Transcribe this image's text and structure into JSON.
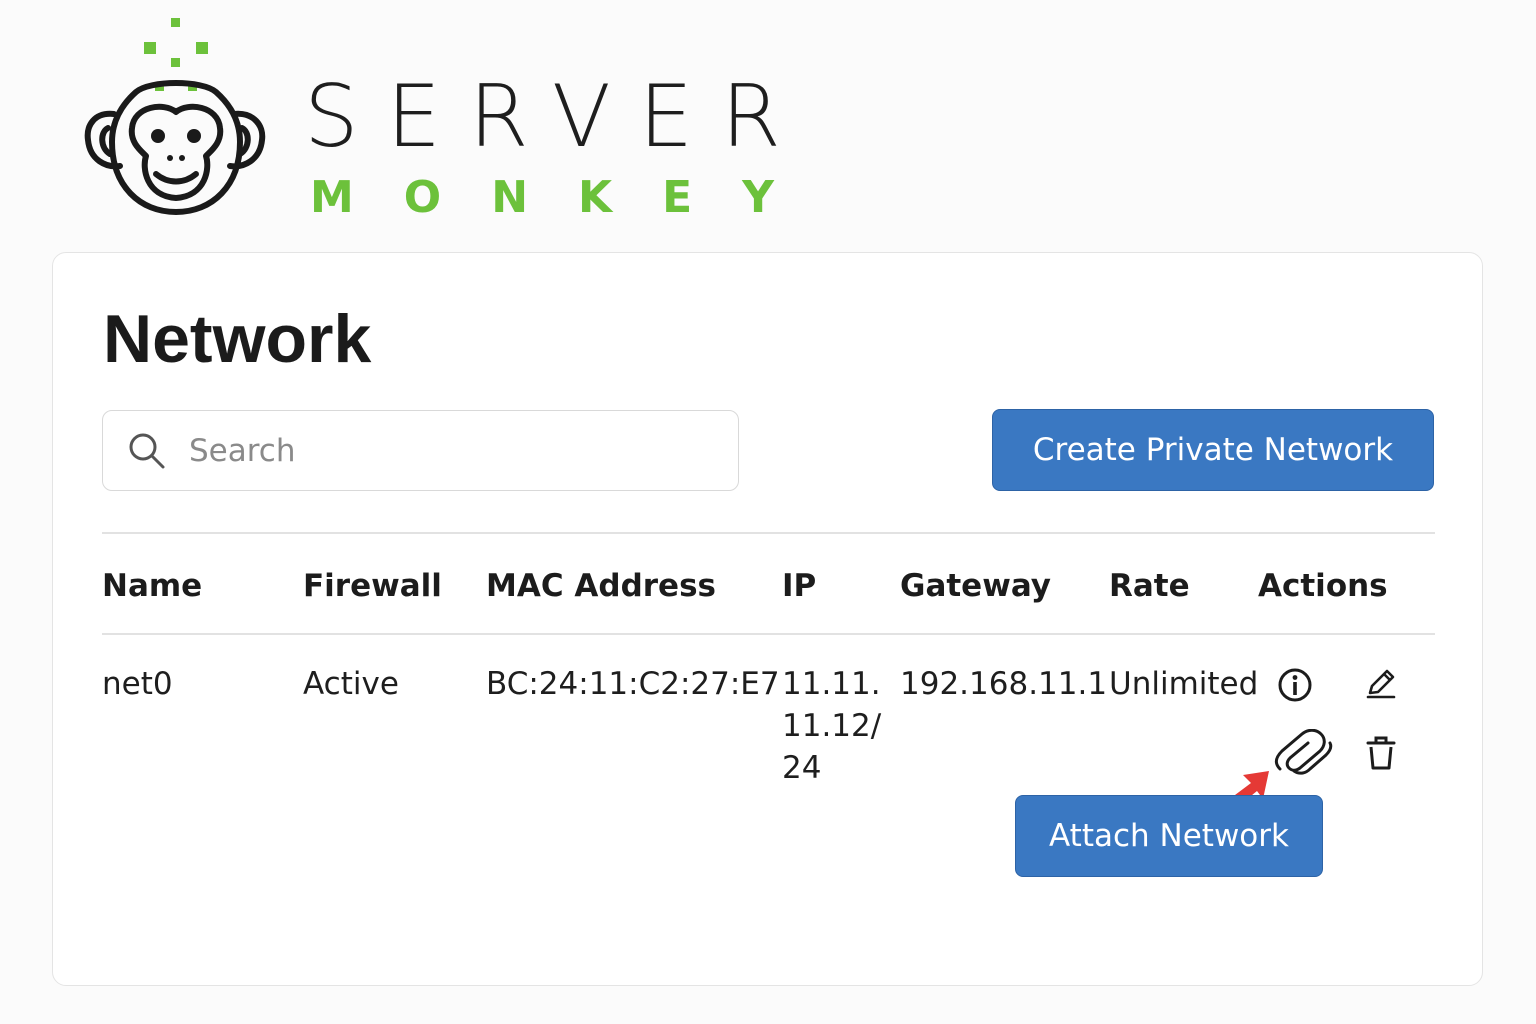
{
  "brand": {
    "word_top": "SERVER",
    "word_bottom": "MONKEY",
    "accent_color": "#6cc13b",
    "icon": "monkey-logo-icon"
  },
  "page": {
    "title": "Network"
  },
  "search": {
    "placeholder": "Search",
    "value": "",
    "icon": "search-icon"
  },
  "actions": {
    "create_label": "Create Private Network",
    "attach_label": "Attach Network",
    "button_color": "#3a78c2"
  },
  "table": {
    "columns": [
      "Name",
      "Firewall",
      "MAC Address",
      "IP",
      "Gateway",
      "Rate",
      "Actions"
    ],
    "rows": [
      {
        "name": "net0",
        "firewall": "Active",
        "mac": "BC:24:11:C2:27:E7",
        "ip": "11.11.11.12/24",
        "gateway": "192.168.11.1",
        "rate": "Unlimited",
        "action_icons": [
          "info-icon",
          "pencil-icon",
          "paperclip-icon",
          "trash-icon"
        ]
      }
    ]
  },
  "annotation": {
    "arrow_color": "#e53935",
    "icon": "red-pointer-arrow-icon"
  }
}
